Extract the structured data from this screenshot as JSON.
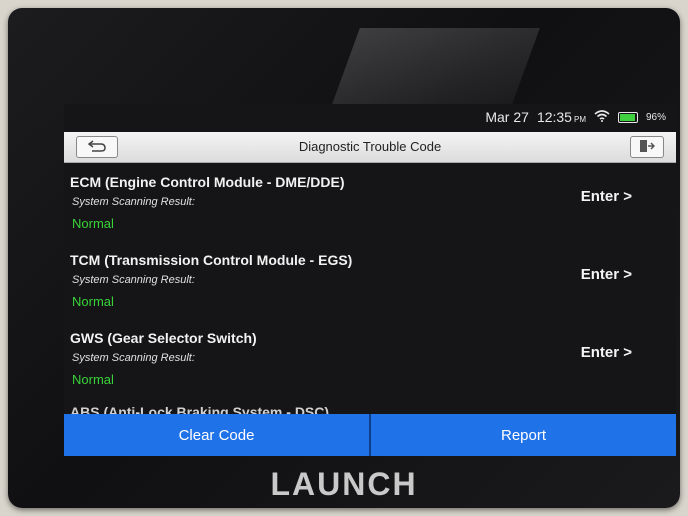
{
  "status": {
    "date": "Mar 27",
    "time": "12:35",
    "ampm": "PM",
    "battery": "96%",
    "wifi_icon": "wifi-icon",
    "battery_icon": "battery-icon"
  },
  "titlebar": {
    "title": "Diagnostic Trouble Code",
    "back_icon": "back-arrow-icon",
    "exit_icon": "exit-icon"
  },
  "modules": [
    {
      "name": "ECM (Engine Control Module - DME/DDE)",
      "subtitle": "System Scanning Result:",
      "status": "Normal",
      "action": "Enter >"
    },
    {
      "name": "TCM (Transmission Control Module - EGS)",
      "subtitle": "System Scanning Result:",
      "status": "Normal",
      "action": "Enter >"
    },
    {
      "name": "GWS (Gear Selector Switch)",
      "subtitle": "System Scanning Result:",
      "status": "Normal",
      "action": "Enter >"
    }
  ],
  "partial_module": "ABS (Anti-Lock Braking System - DSC)",
  "footer": {
    "clear_label": "Clear Code",
    "report_label": "Report"
  },
  "brand": "LAUNCH",
  "colors": {
    "button_blue": "#1f72e8",
    "normal_green": "#39d339"
  }
}
